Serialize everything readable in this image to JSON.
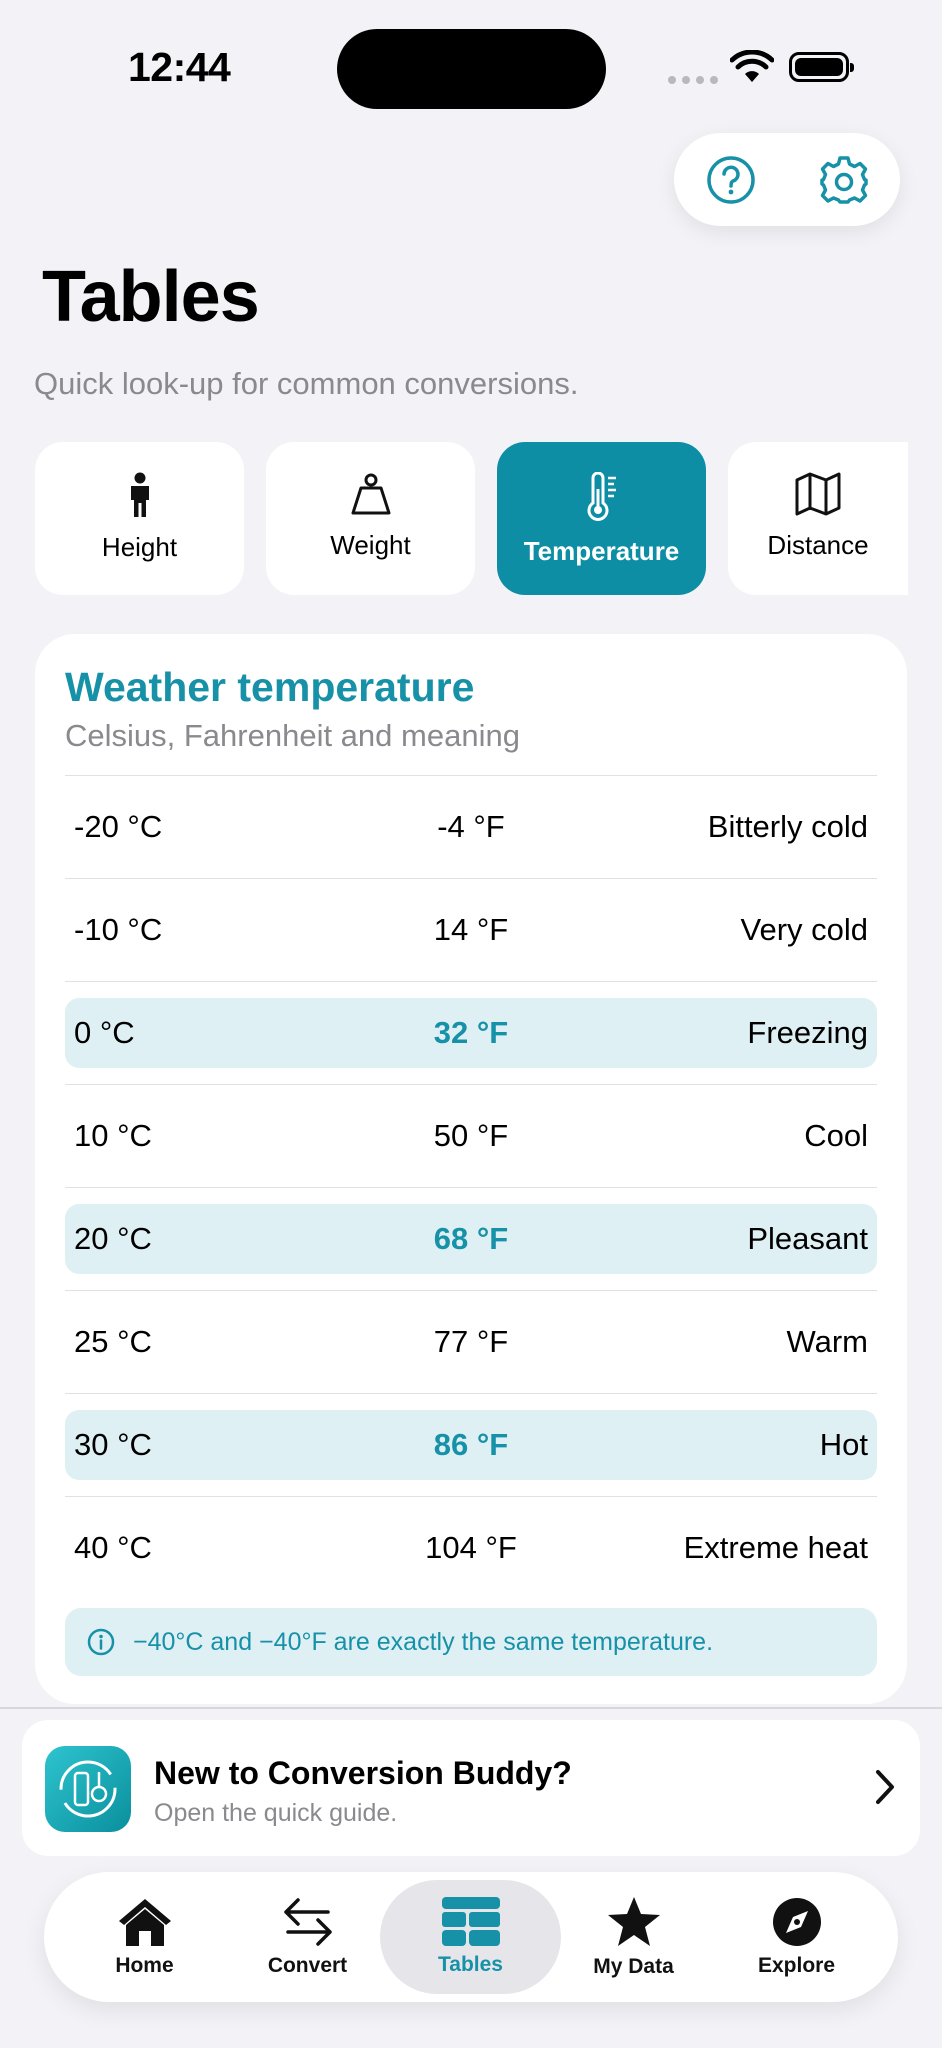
{
  "status": {
    "time": "12:44"
  },
  "header": {
    "title": "Tables",
    "subtitle": "Quick look-up for common conversions."
  },
  "tabs": [
    {
      "label": "Height",
      "icon": "person-icon"
    },
    {
      "label": "Weight",
      "icon": "weight-icon"
    },
    {
      "label": "Temperature",
      "icon": "thermometer-icon",
      "active": true
    },
    {
      "label": "Distance",
      "icon": "map-icon"
    }
  ],
  "card": {
    "title": "Weather temperature",
    "subtitle": "Celsius, Fahrenheit and meaning",
    "rows": [
      {
        "c": "-20 °C",
        "f": "-4 °F",
        "meaning": "Bitterly cold",
        "highlight": false
      },
      {
        "c": "-10 °C",
        "f": "14 °F",
        "meaning": "Very cold",
        "highlight": false
      },
      {
        "c": "0 °C",
        "f": "32 °F",
        "meaning": "Freezing",
        "highlight": true
      },
      {
        "c": "10 °C",
        "f": "50 °F",
        "meaning": "Cool",
        "highlight": false
      },
      {
        "c": "20 °C",
        "f": "68 °F",
        "meaning": "Pleasant",
        "highlight": true
      },
      {
        "c": "25 °C",
        "f": "77 °F",
        "meaning": "Warm",
        "highlight": false
      },
      {
        "c": "30 °C",
        "f": "86 °F",
        "meaning": "Hot",
        "highlight": true
      },
      {
        "c": "40 °C",
        "f": "104 °F",
        "meaning": "Extreme heat",
        "highlight": false
      }
    ],
    "tip": "−40°C and −40°F are exactly the same temperature."
  },
  "banner": {
    "title": "New to Conversion Buddy?",
    "subtitle": "Open the quick guide."
  },
  "nav": [
    {
      "label": "Home",
      "icon": "home-icon"
    },
    {
      "label": "Convert",
      "icon": "arrows-icon"
    },
    {
      "label": "Tables",
      "icon": "table-icon",
      "active": true
    },
    {
      "label": "My Data",
      "icon": "star-icon"
    },
    {
      "label": "Explore",
      "icon": "compass-icon"
    }
  ],
  "colors": {
    "accent": "#0d8ea5",
    "accent_text": "#1691a8",
    "highlight_bg": "#dff0f5",
    "background": "#f2f2f7"
  }
}
